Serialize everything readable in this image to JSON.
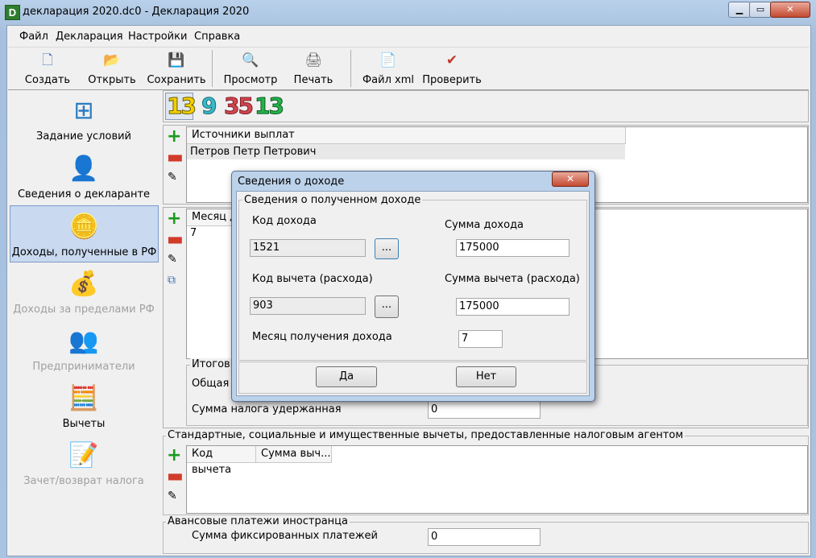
{
  "window": {
    "title": "декларация 2020.dc0 - Декларация 2020",
    "app_icon_letter": "D",
    "min_glyph": "▁",
    "max_glyph": "▭",
    "close_glyph": "✕"
  },
  "menu": [
    "Файл",
    "Декларация",
    "Настройки",
    "Справка"
  ],
  "toolbar": [
    {
      "label": "Создать",
      "icon": "new-document-icon",
      "glyph": "🗋"
    },
    {
      "label": "Открыть",
      "icon": "open-folder-icon",
      "glyph": "📂"
    },
    {
      "label": "Сохранить",
      "icon": "save-disk-icon",
      "glyph": "💾"
    },
    {
      "label": "Просмотр",
      "icon": "preview-icon",
      "glyph": "🔍"
    },
    {
      "label": "Печать",
      "icon": "printer-icon",
      "glyph": "🖨"
    },
    {
      "label": "Файл xml",
      "icon": "xml-export-icon",
      "glyph": "📄"
    },
    {
      "label": "Проверить",
      "icon": "check-document-icon",
      "glyph": "✔"
    }
  ],
  "nav": [
    {
      "label": "Задание условий",
      "icon": "conditions-diagram-icon",
      "glyph": "⊞",
      "state": "normal"
    },
    {
      "label": "Сведения о декларанте",
      "icon": "person-icon",
      "glyph": "👤",
      "state": "normal"
    },
    {
      "label": "Доходы, полученные в РФ",
      "icon": "coins-icon",
      "glyph": "🪙",
      "state": "active"
    },
    {
      "label": "Доходы за пределами РФ",
      "icon": "money-bag-icon",
      "glyph": "💰",
      "state": "disabled"
    },
    {
      "label": "Предприниматели",
      "icon": "entrepreneur-icon",
      "glyph": "👥",
      "state": "disabled"
    },
    {
      "label": "Вычеты",
      "icon": "calculator-icon",
      "glyph": "🧮",
      "state": "normal"
    },
    {
      "label": "Зачет/возврат налога",
      "icon": "tax-return-icon",
      "glyph": "📝",
      "state": "disabled"
    }
  ],
  "rate_tabs": [
    {
      "label": "13",
      "color": "#f2d100"
    },
    {
      "label": "9",
      "color": "#37b9c8"
    },
    {
      "label": "35",
      "color": "#d2454f"
    },
    {
      "label": "13",
      "color": "#25b24a"
    }
  ],
  "sources": {
    "header": "Источники выплат",
    "rows": [
      "Петров Петр Петрович"
    ]
  },
  "income": {
    "header_month": "Месяц дохода",
    "rows": [
      "7"
    ]
  },
  "totals": {
    "legend": "Итоговые суммы по источнику выплат",
    "total_label": "Общая сумма дохода",
    "withheld_label": "Сумма налога удержанная",
    "withheld_value": "0"
  },
  "deductions": {
    "legend": "Стандартные, социальные и имущественные вычеты, предоставленные налоговым агентом",
    "col_code": "Код вычета",
    "col_sum": "Сумма выч..."
  },
  "advance": {
    "legend": "Авансовые платежи иностранца",
    "label": "Сумма фиксированных платежей",
    "value": "0"
  },
  "icons": {
    "plus": "+",
    "minus": "▬",
    "edit": "✎",
    "copy": "⧉"
  },
  "dialog": {
    "title": "Сведения о доходе",
    "group_legend": "Сведения о полученном доходе",
    "income_code_label": "Код дохода",
    "income_code_value": "1521",
    "income_sum_label": "Сумма дохода",
    "income_sum_value": "175000",
    "deduction_code_label": "Код вычета (расхода)",
    "deduction_code_value": "903",
    "deduction_sum_label": "Сумма вычета (расхода)",
    "deduction_sum_value": "175000",
    "month_label": "Месяц получения дохода",
    "month_value": "7",
    "browse_label": "...",
    "yes_label": "Да",
    "no_label": "Нет",
    "close_glyph": "✕"
  }
}
